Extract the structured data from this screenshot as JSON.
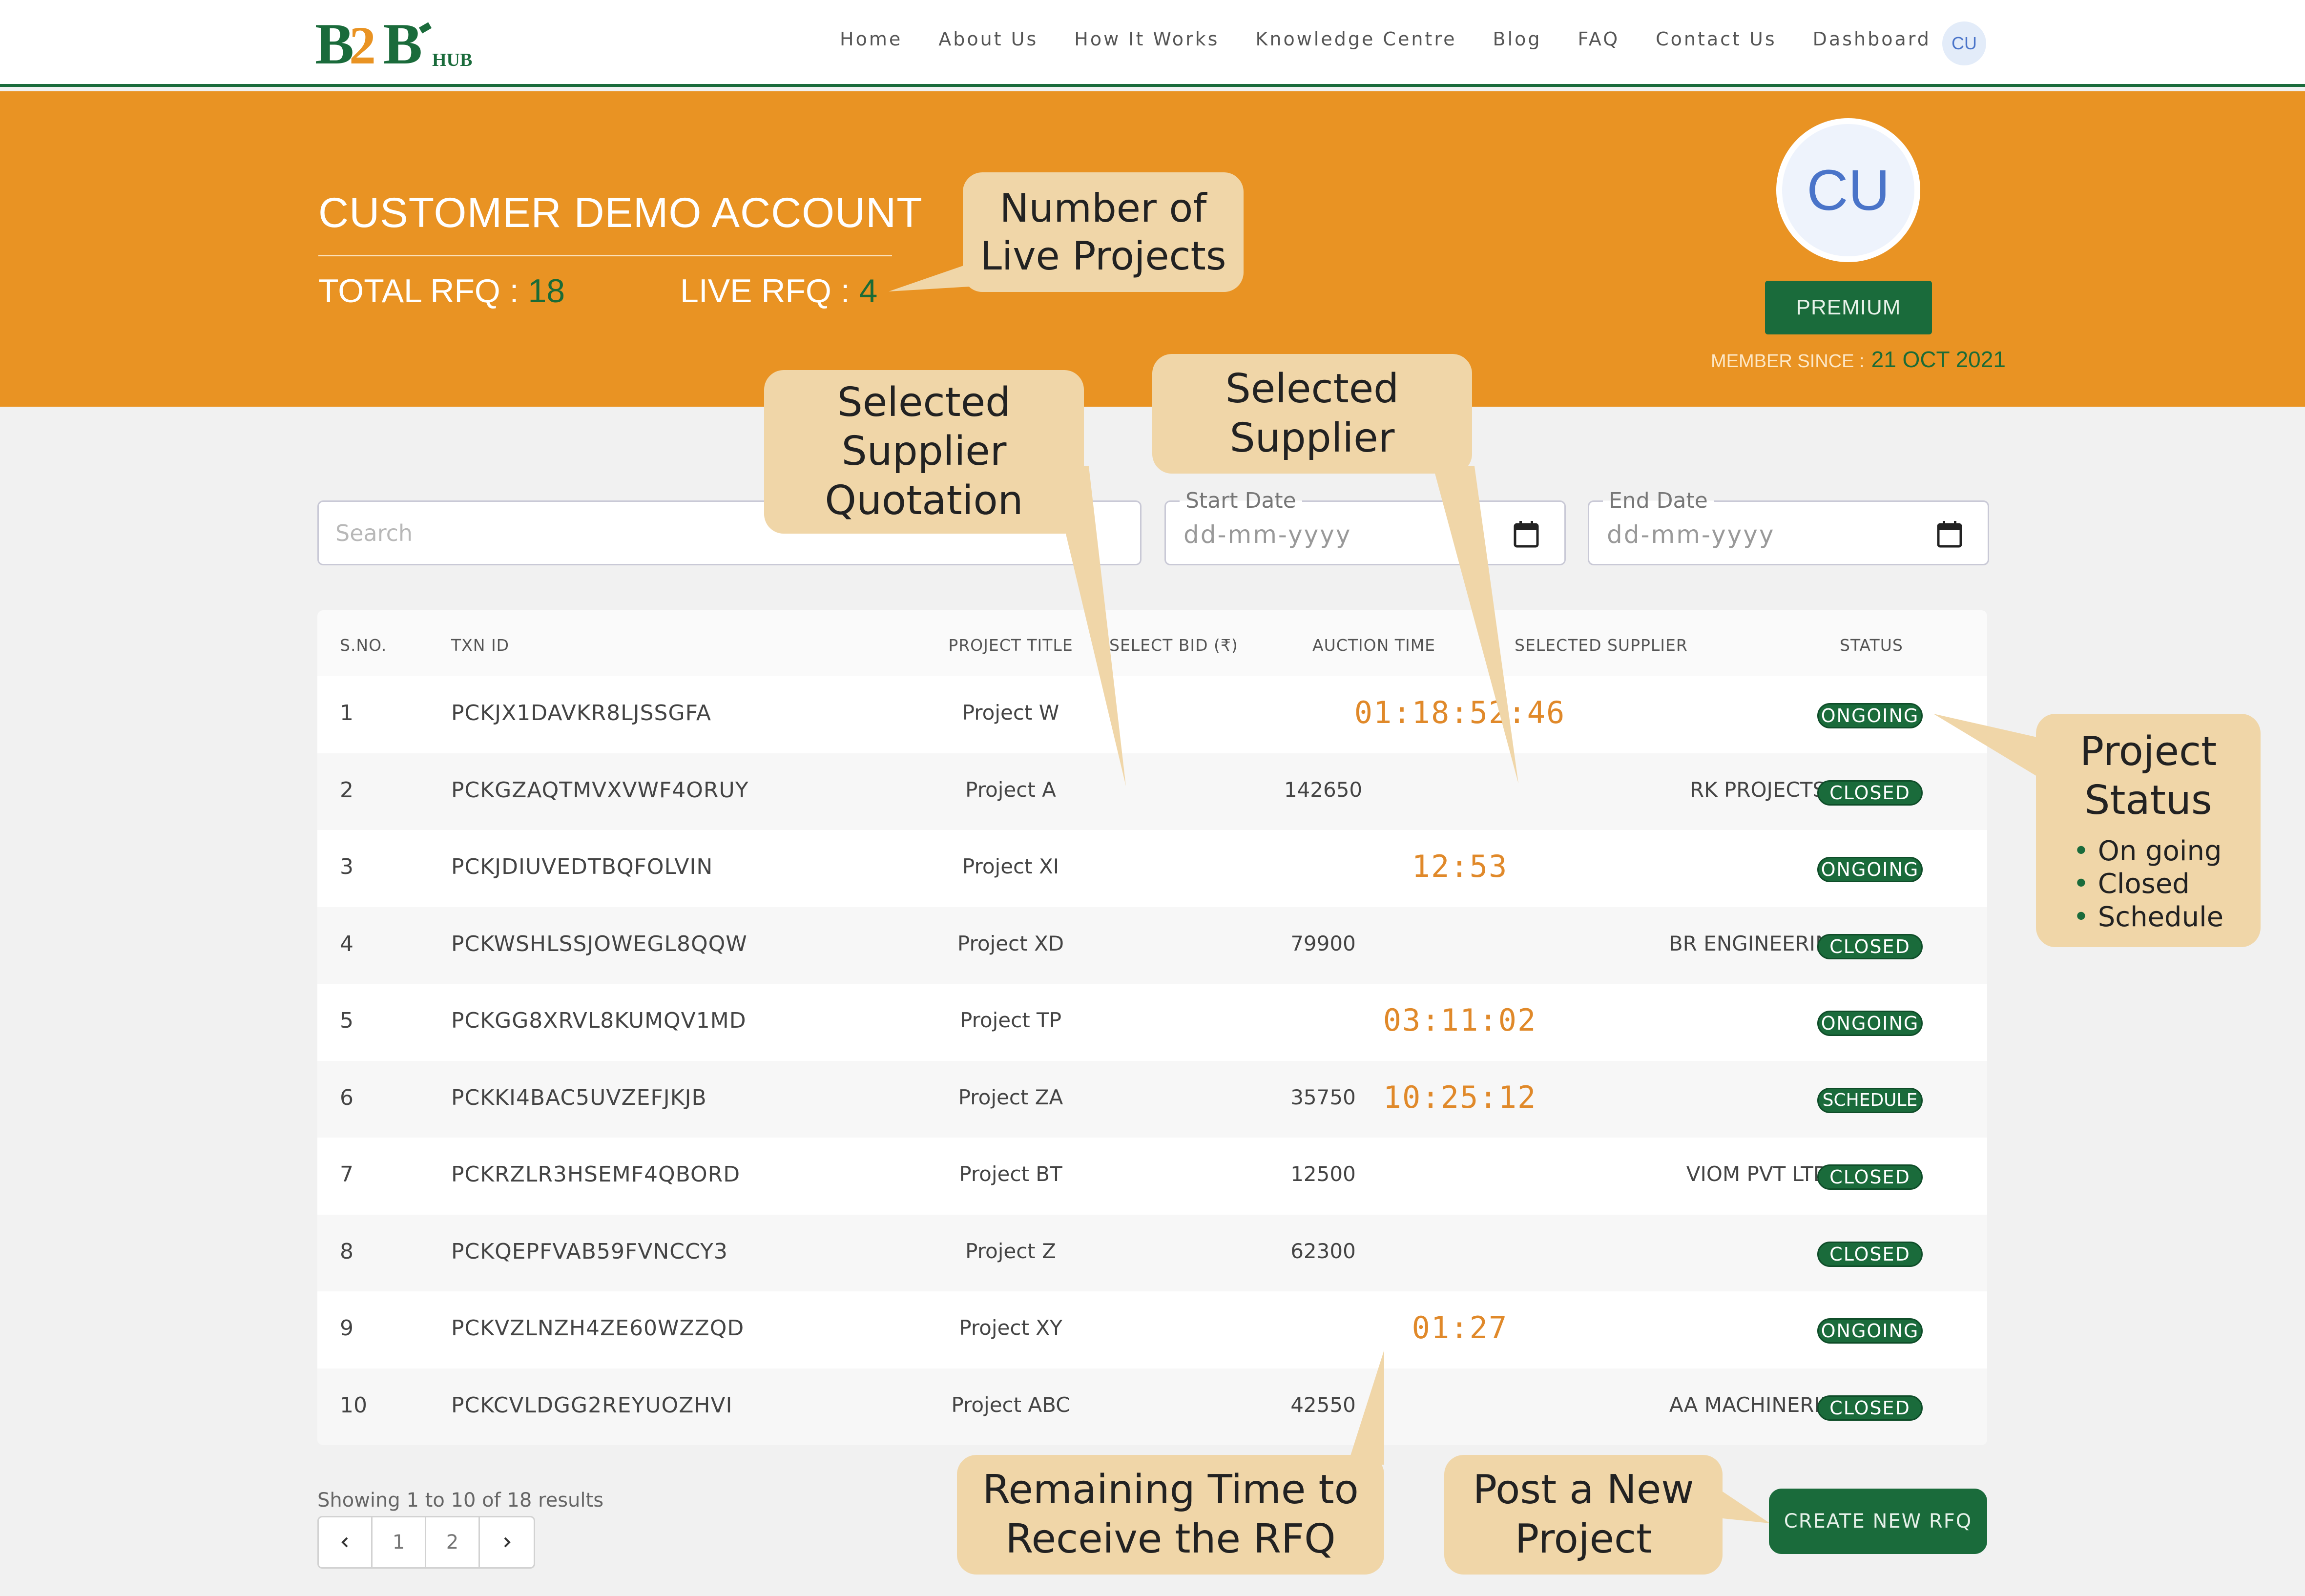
{
  "colors": {
    "brand_green": "#1a6b3b",
    "hero_orange": "#e99323",
    "timer_orange": "#e0892a",
    "callout_bg": "#f0d6a8"
  },
  "nav": {
    "logo_text": "B2B HUB",
    "links": [
      "Home",
      "About Us",
      "How It Works",
      "Knowledge Centre",
      "Blog",
      "FAQ",
      "Contact Us",
      "Dashboard"
    ],
    "avatar_initials": "CU"
  },
  "hero": {
    "account_title": "CUSTOMER DEMO ACCOUNT",
    "total_rfq_label": "TOTAL RFQ : ",
    "total_rfq_value": "18",
    "live_rfq_label": "LIVE  RFQ : ",
    "live_rfq_value": "4",
    "avatar_initials": "CU",
    "plan": "PREMIUM",
    "member_since_label": "MEMBER SINCE :",
    "member_since_value": "21 OCT 2021"
  },
  "filters": {
    "search_placeholder": "Search",
    "start_date_label": "Start Date",
    "end_date_label": "End Date",
    "date_placeholder": "dd-mm-yyyy"
  },
  "table": {
    "headers": [
      "S.NO.",
      "TXN ID",
      "PROJECT TITLE",
      "SELECT BID (₹)",
      "AUCTION TIME",
      "SELECTED SUPPLIER",
      "STATUS"
    ],
    "rows": [
      {
        "sno": "1",
        "txn": "PCKJX1DAVKR8LJSSGFA",
        "title": "Project W",
        "bid": "",
        "time": "01:18:52:46",
        "supplier": "",
        "status": "ONGOING"
      },
      {
        "sno": "2",
        "txn": "PCKGZAQTMVXVWF4ORUY",
        "title": "Project A",
        "bid": "142650",
        "time": "",
        "supplier": "RK PROJECTS",
        "status": "CLOSED"
      },
      {
        "sno": "3",
        "txn": "PCKJDIUVEDTBQFOLVIN",
        "title": "Project XI",
        "bid": "",
        "time": "12:53",
        "supplier": "",
        "status": "ONGOING"
      },
      {
        "sno": "4",
        "txn": "PCKWSHLSSJOWEGL8QQW",
        "title": "Project XD",
        "bid": "79900",
        "time": "",
        "supplier": "BR ENGINEERING",
        "status": "CLOSED"
      },
      {
        "sno": "5",
        "txn": "PCKGG8XRVL8KUMQV1MD",
        "title": "Project TP",
        "bid": "",
        "time": "03:11:02",
        "supplier": "",
        "status": "ONGOING"
      },
      {
        "sno": "6",
        "txn": "PCKKI4BAC5UVZEFJKJB",
        "title": "Project ZA",
        "bid": "35750",
        "time": "10:25:12",
        "supplier": "",
        "status": "SCHEDULE"
      },
      {
        "sno": "7",
        "txn": "PCKRZLR3HSEMF4QBORD",
        "title": "Project BT",
        "bid": "12500",
        "time": "",
        "supplier": "VIOM PVT LTD",
        "status": "CLOSED"
      },
      {
        "sno": "8",
        "txn": "PCKQEPFVAB59FVNCCY3",
        "title": "Project Z",
        "bid": "62300",
        "time": "",
        "supplier": "",
        "status": "CLOSED"
      },
      {
        "sno": "9",
        "txn": "PCKVZLNZH4ZE60WZZQD",
        "title": "Project XY",
        "bid": "",
        "time": "01:27",
        "supplier": "",
        "status": "ONGOING"
      },
      {
        "sno": "10",
        "txn": "PCKCVLDGG2REYUOZHVI",
        "title": "Project ABC",
        "bid": "42550",
        "time": "",
        "supplier": "AA MACHINERIES",
        "status": "CLOSED"
      }
    ]
  },
  "pagination": {
    "showing": "Showing 1 to 10 of 18 results",
    "prev_icon": "chevron-left-icon",
    "pages": [
      "1",
      "2"
    ],
    "next_icon": "chevron-right-icon"
  },
  "actions": {
    "create_rfq": "CREATE NEW RFQ"
  },
  "callouts": {
    "live_projects": "Number of\nLive Projects",
    "supplier_quotation": "Selected\nSupplier\nQuotation",
    "selected_supplier": "Selected\nSupplier",
    "project_status_title": "Project\nStatus",
    "project_status_items": [
      "On going",
      "Closed",
      "Schedule"
    ],
    "remaining_time": "Remaining Time to\nReceive the RFQ",
    "post_new_project": "Post a New\nProject"
  }
}
